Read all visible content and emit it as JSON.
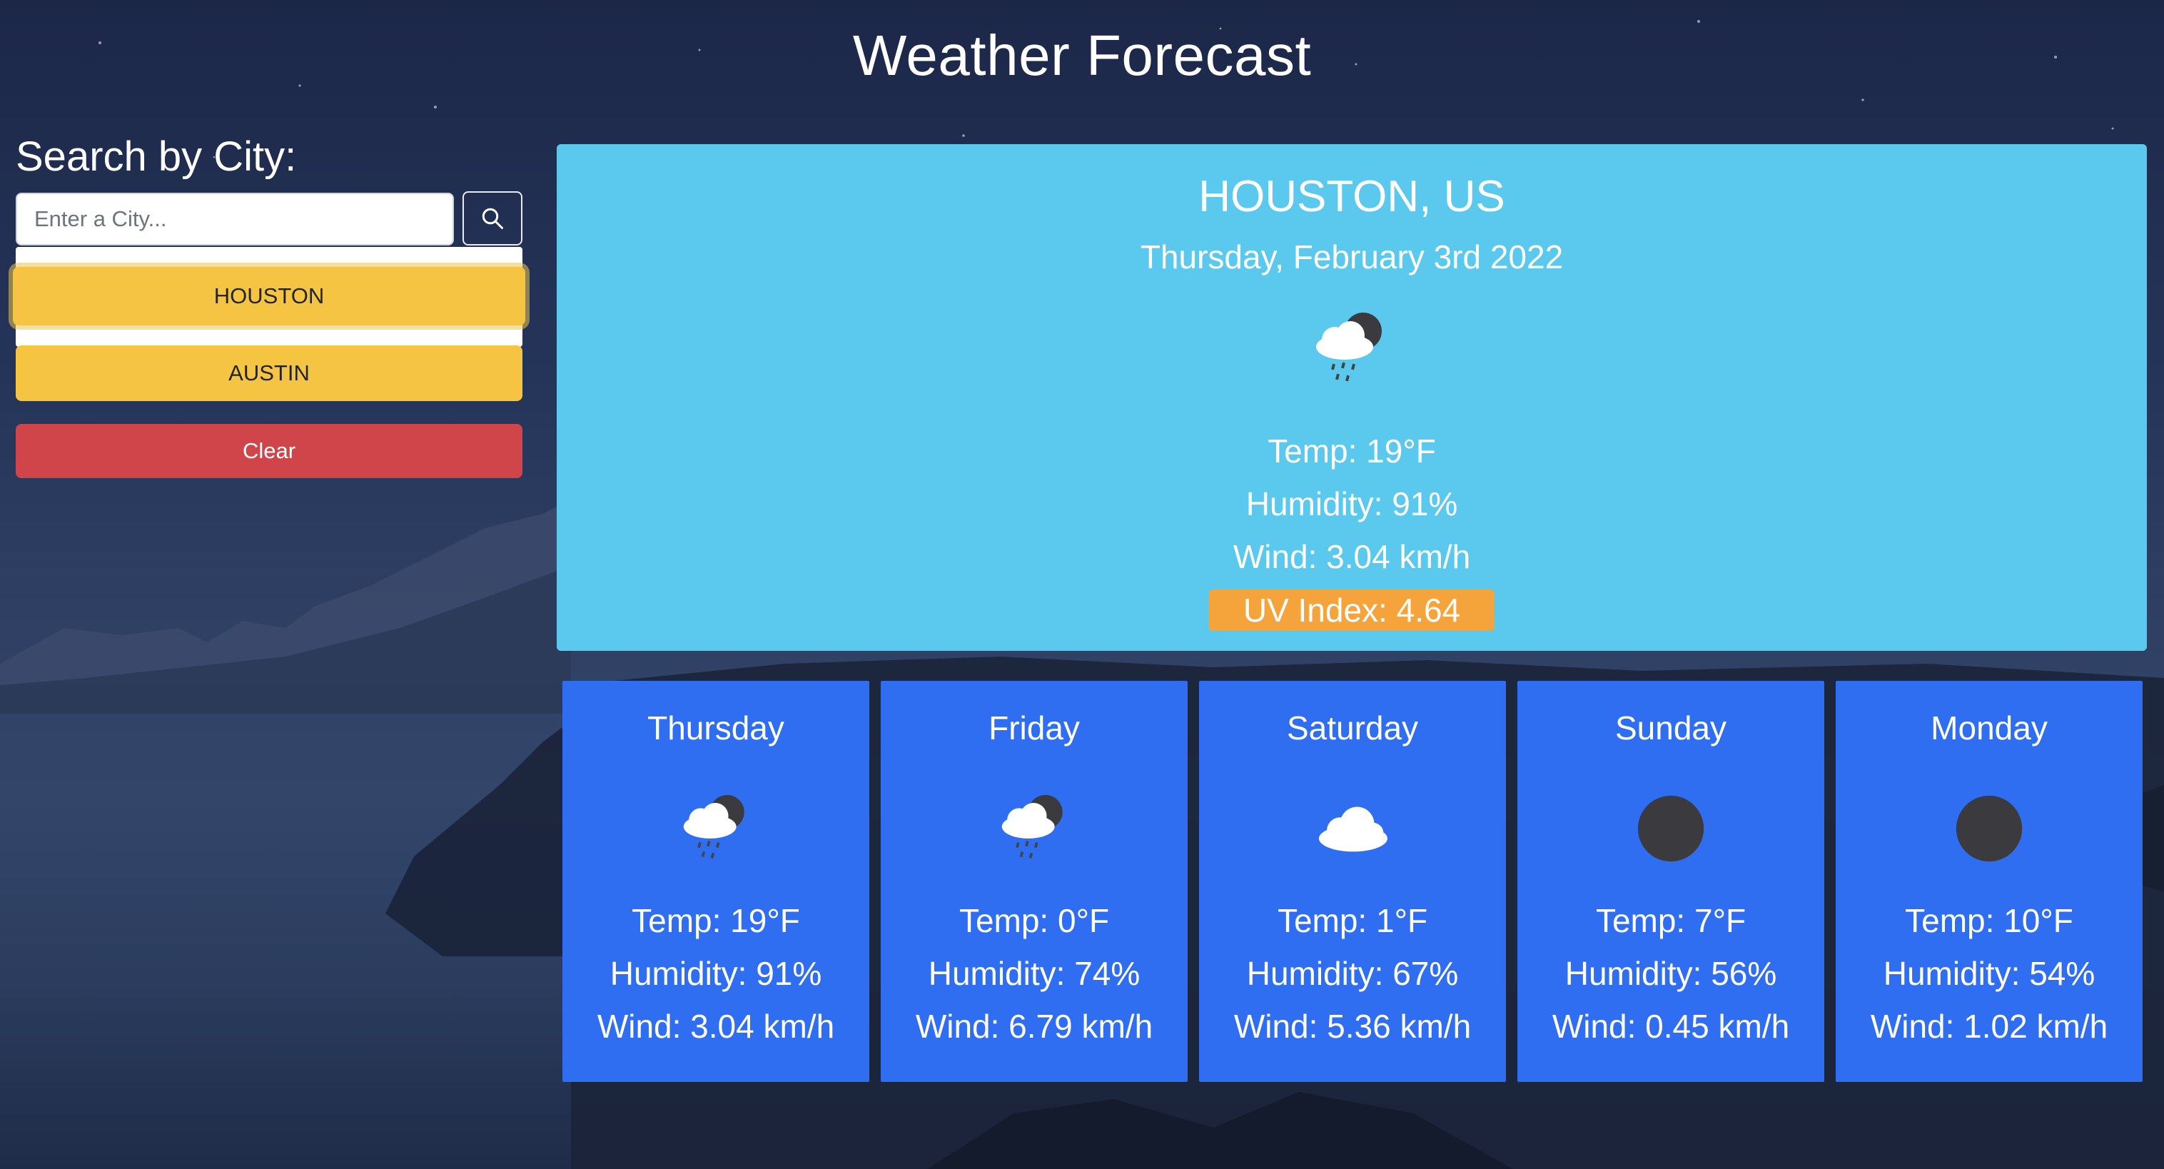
{
  "header": {
    "title": "Weather Forecast"
  },
  "search": {
    "label": "Search by City:",
    "placeholder": "Enter a City...",
    "value": "",
    "button_icon": "search-icon"
  },
  "history": {
    "cities": [
      {
        "label": "HOUSTON",
        "state": "focused"
      },
      {
        "label": "AUSTIN",
        "state": "default"
      }
    ],
    "clear_label": "Clear"
  },
  "current": {
    "city": "HOUSTON, US",
    "date": "Thursday, February 3rd 2022",
    "icon": "rain-night-icon",
    "temp": "Temp: 19°F",
    "humidity": "Humidity: 91%",
    "wind": "Wind: 3.04 km/h",
    "uv": "UV Index: 4.64"
  },
  "forecast": [
    {
      "day": "Thursday",
      "icon": "rain-night-icon",
      "temp": "Temp: 19°F",
      "humidity": "Humidity: 91%",
      "wind": "Wind: 3.04 km/h"
    },
    {
      "day": "Friday",
      "icon": "rain-night-icon",
      "temp": "Temp: 0°F",
      "humidity": "Humidity: 74%",
      "wind": "Wind: 6.79 km/h"
    },
    {
      "day": "Saturday",
      "icon": "cloud-icon",
      "temp": "Temp: 1°F",
      "humidity": "Humidity: 67%",
      "wind": "Wind: 5.36 km/h"
    },
    {
      "day": "Sunday",
      "icon": "clear-night-icon",
      "temp": "Temp: 7°F",
      "humidity": "Humidity: 56%",
      "wind": "Wind: 0.45 km/h"
    },
    {
      "day": "Monday",
      "icon": "clear-night-icon",
      "temp": "Temp: 10°F",
      "humidity": "Humidity: 54%",
      "wind": "Wind: 1.02 km/h"
    }
  ],
  "colors": {
    "current_panel": "#5bc8ee",
    "forecast_card": "#2f6ef0",
    "city_button": "#f6c443",
    "clear_button": "#d0454a",
    "uv_badge": "#f5a33b"
  }
}
